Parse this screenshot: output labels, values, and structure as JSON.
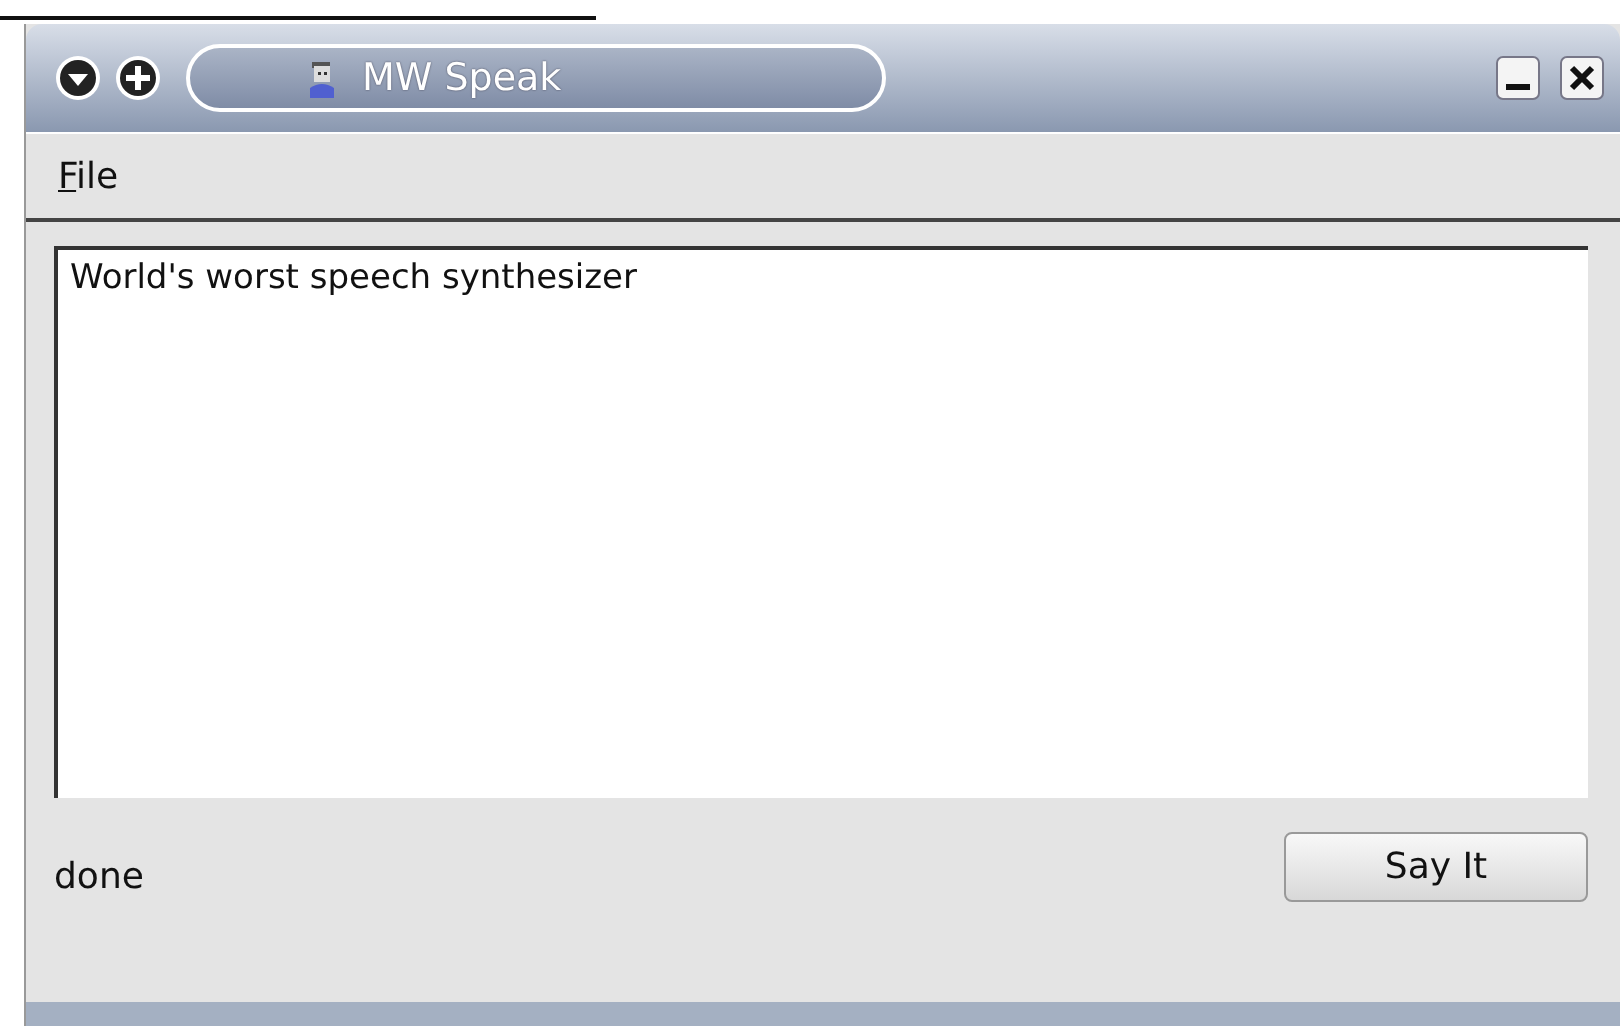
{
  "window": {
    "title": "MW Speak"
  },
  "menu": [
    {
      "label": "File"
    }
  ],
  "text_area": {
    "value": "World's worst speech synthesizer"
  },
  "status": "done",
  "buttons": [
    {
      "label": "Say It"
    }
  ]
}
